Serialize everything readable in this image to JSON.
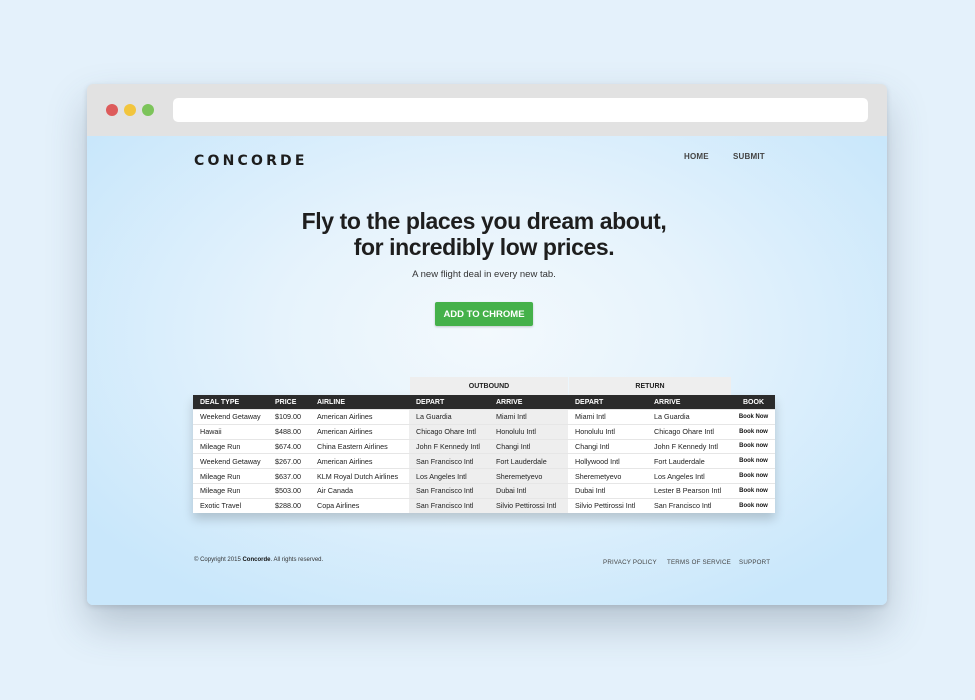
{
  "window": {
    "dots": [
      "#dd5b5b",
      "#f2c53d",
      "#7cc45a"
    ],
    "url": ""
  },
  "header": {
    "logo": "CONCORDE",
    "nav": [
      {
        "label": "HOME"
      },
      {
        "label": "SUBMIT"
      }
    ]
  },
  "hero": {
    "title_line1": "Fly to the places you dream about,",
    "title_line2": "for incredibly low prices.",
    "subtitle": "A new flight deal in every new tab.",
    "cta_label": "ADD TO CHROME",
    "cta_color": "#45b14a"
  },
  "deals": {
    "group_headers": {
      "outbound": "OUTBOUND",
      "return": "RETURN"
    },
    "columns": [
      "DEAL TYPE",
      "PRICE",
      "AIRLINE",
      "DEPART",
      "ARRIVE",
      "DEPART",
      "ARRIVE",
      "BOOK"
    ],
    "rows": [
      {
        "type": "Weekend Getaway",
        "price": "$109.00",
        "airline": "American Airlines",
        "out_depart": "La Guardia",
        "out_arrive": "Miami Intl",
        "ret_depart": "Miami Intl",
        "ret_arrive": "La Guardia",
        "book": "Book Now"
      },
      {
        "type": "Hawaii",
        "price": "$488.00",
        "airline": "American Airlines",
        "out_depart": "Chicago Ohare Intl",
        "out_arrive": "Honolulu Intl",
        "ret_depart": "Honolulu Intl",
        "ret_arrive": "Chicago Ohare Intl",
        "book": "Book now"
      },
      {
        "type": "Mileage Run",
        "price": "$674.00",
        "airline": "China Eastern Airlines",
        "out_depart": "John F Kennedy Intl",
        "out_arrive": "Changi Intl",
        "ret_depart": "Changi Intl",
        "ret_arrive": "John F Kennedy Intl",
        "book": "Book now"
      },
      {
        "type": "Weekend Getaway",
        "price": "$267.00",
        "airline": "American Airlines",
        "out_depart": "San Francisco Intl",
        "out_arrive": "Fort Lauderdale",
        "ret_depart": "Hollywood Intl",
        "ret_arrive": "Fort Lauderdale",
        "book": "Book now"
      },
      {
        "type": "Mileage Run",
        "price": "$637.00",
        "airline": "KLM Royal Dutch Airlines",
        "out_depart": "Los Angeles Intl",
        "out_arrive": "Sheremetyevo",
        "ret_depart": "Sheremetyevo",
        "ret_arrive": "Los Angeles Intl",
        "book": "Book now"
      },
      {
        "type": "Mileage Run",
        "price": "$503.00",
        "airline": "Air Canada",
        "out_depart": "San Francisco Intl",
        "out_arrive": "Dubai Intl",
        "ret_depart": "Dubai Intl",
        "ret_arrive": "Lester B Pearson Intl",
        "book": "Book now"
      },
      {
        "type": "Exotic Travel",
        "price": "$288.00",
        "airline": "Copa Airlines",
        "out_depart": "San Francisco Intl",
        "out_arrive": "Silvio Pettirossi Intl",
        "ret_depart": "Silvio Pettirossi Intl",
        "ret_arrive": "San Francisco Intl",
        "book": "Book now"
      }
    ]
  },
  "footer": {
    "copyright_prefix": "© Copyright 2015",
    "copyright_brand": "Concorde",
    "copyright_suffix": ". All rights reserved.",
    "links": [
      {
        "label": "PRIVACY POLICY"
      },
      {
        "label": "TERMS OF SERVICE"
      },
      {
        "label": "SUPPORT"
      }
    ]
  }
}
